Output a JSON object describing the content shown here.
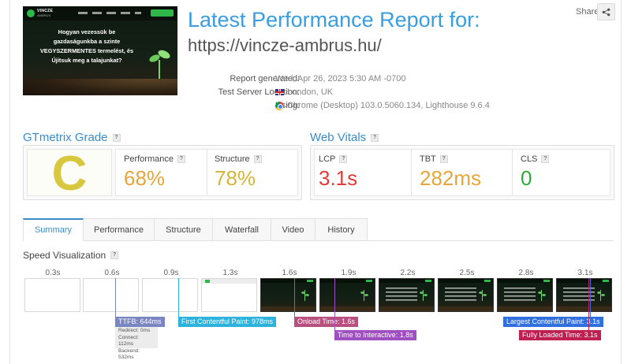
{
  "thumbnail": {
    "brand": "VINCZE",
    "brand_sub": "AMBRUS",
    "hero_lines": [
      "Hogyan vezessük be",
      "gazdaságunkba a szinte",
      "VEGYSZERMENTES termelést, és",
      "Újítsuk meg a talajunkat?"
    ]
  },
  "report": {
    "title": "Latest Performance Report for:",
    "url": "https://vincze-ambrus.hu/",
    "share_label": "Share",
    "meta": [
      {
        "label": "Report generated:",
        "value": "Wed, Apr 26, 2023 5:30 AM -0700",
        "icon": ""
      },
      {
        "label": "Test Server Location:",
        "value": "London, UK",
        "icon": "uk-flag-icon"
      },
      {
        "label": "Using:",
        "value": "Chrome (Desktop) 103.0.5060.134, Lighthouse 9.6.4",
        "icon": "chrome-icon"
      }
    ]
  },
  "grade": {
    "title": "GTmetrix Grade",
    "letter": "C",
    "performance_label": "Performance",
    "performance_value": "68%",
    "structure_label": "Structure",
    "structure_value": "78%"
  },
  "vitals": {
    "title": "Web Vitals",
    "lcp_label": "LCP",
    "lcp_value": "3.1s",
    "tbt_label": "TBT",
    "tbt_value": "282ms",
    "cls_label": "CLS",
    "cls_value": "0"
  },
  "tabs": [
    "Summary",
    "Performance",
    "Structure",
    "Waterfall",
    "Video",
    "History"
  ],
  "speed": {
    "title": "Speed Visualization",
    "times": [
      "0.3s",
      "0.6s",
      "0.9s",
      "1.3s",
      "1.6s",
      "1.9s",
      "2.2s",
      "2.5s",
      "2.8s",
      "3.1s"
    ],
    "markers": {
      "ttfb": "TTFB: 644ms",
      "fcp": "First Contentful Paint: 978ms",
      "onload": "Onload Time: 1.6s",
      "tti": "Time to Interactive: 1.8s",
      "lcp": "Largest Contentful Paint: 3.1s",
      "fully_loaded": "Fully Loaded Time: 3.1s"
    },
    "ttfb_details": [
      "Redirect: 0ms",
      "Connect: 112ms",
      "Backend: 532ms"
    ]
  },
  "colors": {
    "accent": "#3a8cc8",
    "grade_c": "#d8c840",
    "perf": "#e8a53a",
    "struct": "#d6b63a",
    "bad": "#e03b3b",
    "good": "#2eaa3a",
    "ttfb": "#7a86c2",
    "fcp": "#2bb3de",
    "onload": "#b84f7e",
    "tti": "#9e4fc0",
    "lcp": "#2f6fe0",
    "fully": "#c01f52"
  }
}
